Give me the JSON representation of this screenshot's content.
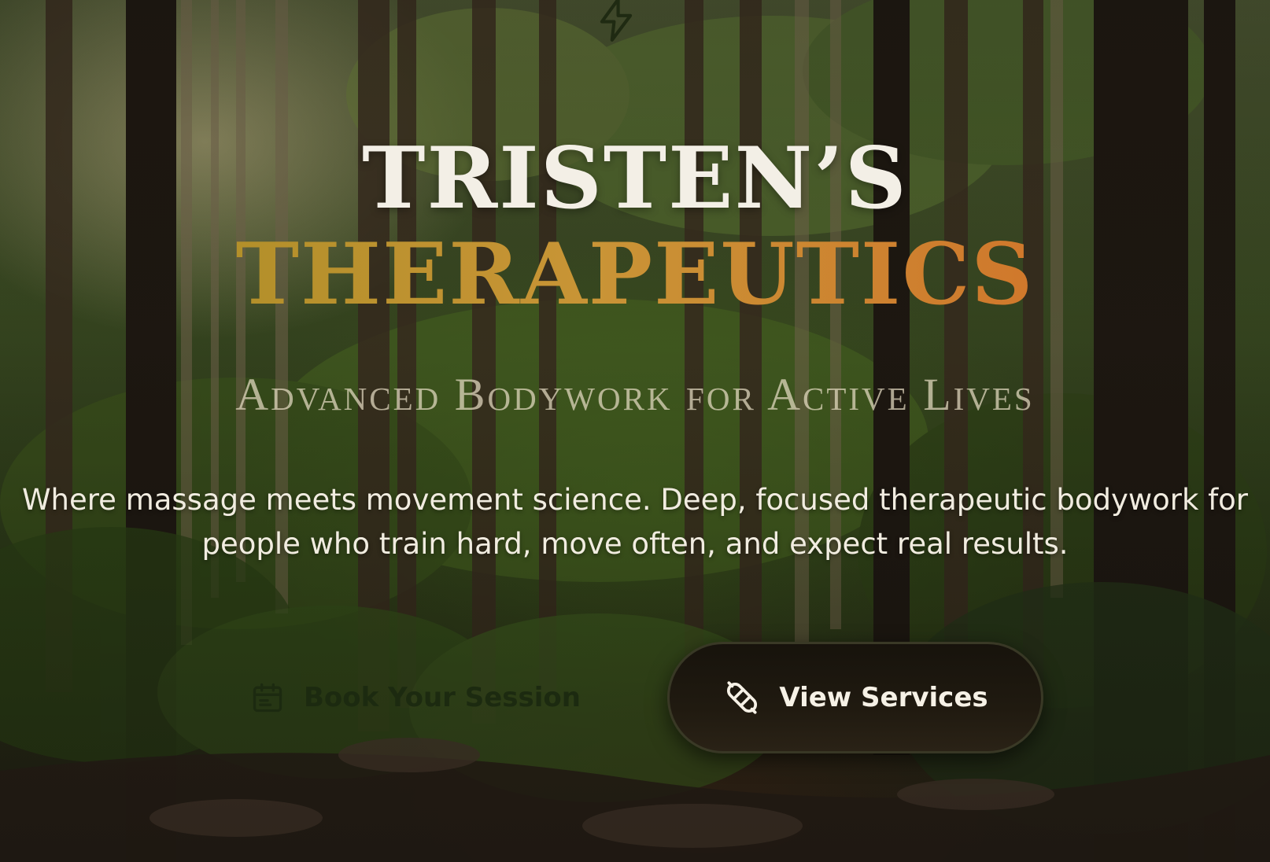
{
  "hero": {
    "icon": "bolt-icon",
    "title_line1": "TRISTEN’S",
    "title_line2": "THERAPEUTICS",
    "tagline": "Advanced Bodywork for Active Lives",
    "description": "Where massage meets movement science. Deep, focused therapeutic bodywork for people who train hard, move often, and expect real results."
  },
  "actions": {
    "book": {
      "label": "Book Your Session",
      "icon": "calendar-icon"
    },
    "services": {
      "label": "View Services",
      "icon": "bandage-icon"
    }
  },
  "colors": {
    "title_primary": "#f3efe6",
    "title_gold_start": "#b3902a",
    "title_gold_end": "#d0782c",
    "button_dark": "#17130c"
  }
}
